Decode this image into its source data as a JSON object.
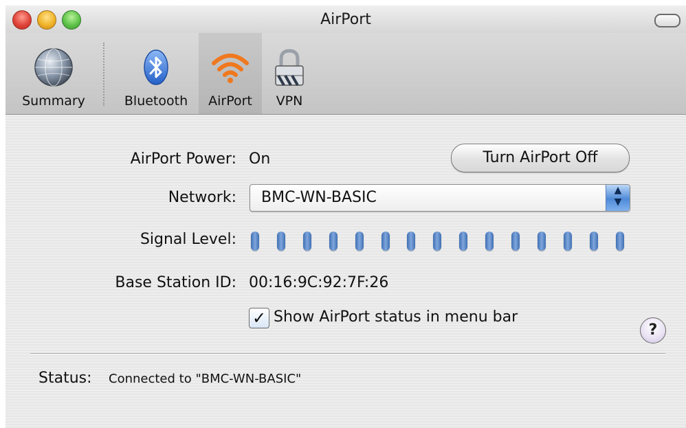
{
  "window": {
    "title": "AirPort"
  },
  "toolbar": {
    "items": [
      {
        "label": "Summary",
        "icon": "globe-icon"
      },
      {
        "label": "Bluetooth",
        "icon": "bluetooth-icon"
      },
      {
        "label": "AirPort",
        "icon": "airport-wifi-icon",
        "selected": true
      },
      {
        "label": "VPN",
        "icon": "lock-icon"
      }
    ]
  },
  "airport": {
    "power_label": "AirPort Power:",
    "power_value": "On",
    "toggle_button": "Turn AirPort Off",
    "network_label": "Network:",
    "network_value": "BMC-WN-BASIC",
    "signal_label": "Signal Level:",
    "signal_bars": 15,
    "base_station_label": "Base Station ID:",
    "base_station_value": "00:16:9C:92:7F:26",
    "menubar_checkbox_label": "Show AirPort status in menu bar",
    "menubar_checkbox_checked": true,
    "help_label": "?"
  },
  "status": {
    "label": "Status:",
    "value": "Connected to \"BMC-WN-BASIC\""
  },
  "colors": {
    "signal_bar": "#4f7fc4",
    "airport_icon": "#f0781e",
    "bluetooth_icon": "#3b7be0"
  }
}
